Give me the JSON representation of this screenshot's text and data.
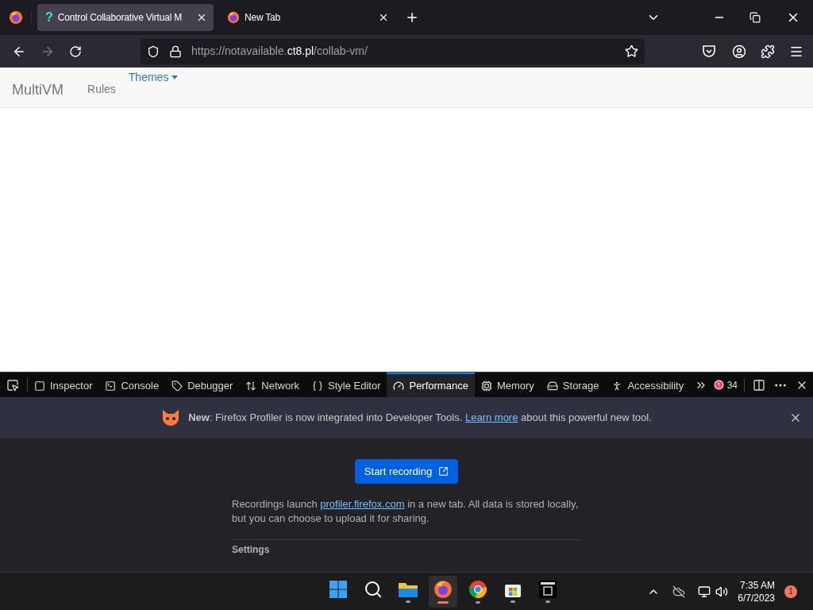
{
  "browser_tabs": [
    {
      "favicon": "?",
      "title": "Control Collaborative Virtual M",
      "selected": true
    },
    {
      "title": "New Tab",
      "selected": false
    }
  ],
  "address_bar": {
    "url_prefix": "https://notavailable.",
    "url_domain": "ct8.pl",
    "url_path": "/collab-vm/"
  },
  "page": {
    "brand": "MultiVM",
    "nav": [
      {
        "label": "Rules",
        "kind": "link"
      },
      {
        "label": "Themes",
        "kind": "dropdown"
      }
    ]
  },
  "devtools": {
    "tabs": [
      {
        "label": "Inspector",
        "selected": false
      },
      {
        "label": "Console",
        "selected": false
      },
      {
        "label": "Debugger",
        "selected": false
      },
      {
        "label": "Network",
        "selected": false
      },
      {
        "label": "Style Editor",
        "selected": false
      },
      {
        "label": "Performance",
        "selected": true
      },
      {
        "label": "Memory",
        "selected": false
      },
      {
        "label": "Storage",
        "selected": false
      },
      {
        "label": "Accessibility",
        "selected": false
      }
    ],
    "error_count": "34",
    "notice": {
      "text": "**New**: Firefox Profiler is now integrated into Developer Tools.",
      "link": "Learn more",
      "after": "about this powerful new tool."
    },
    "button": "Start recording",
    "info_before": "Recordings launch",
    "info_link": "profiler.firefox.com",
    "info_after": "in a new tab. All data is stored locally, but you can choose to upload it for sharing.",
    "section": "Settings"
  },
  "taskbar": {
    "apps": [
      {
        "selected": false,
        "running": false
      },
      {
        "selected": false,
        "running": false
      },
      {
        "selected": false,
        "running": true
      },
      {
        "selected": true,
        "running": true
      },
      {
        "selected": false,
        "running": true
      },
      {
        "selected": false,
        "running": true
      },
      {
        "selected": false,
        "running": true
      }
    ],
    "time": "7:35 AM",
    "date": "6/7/2023",
    "notifications": "1"
  }
}
